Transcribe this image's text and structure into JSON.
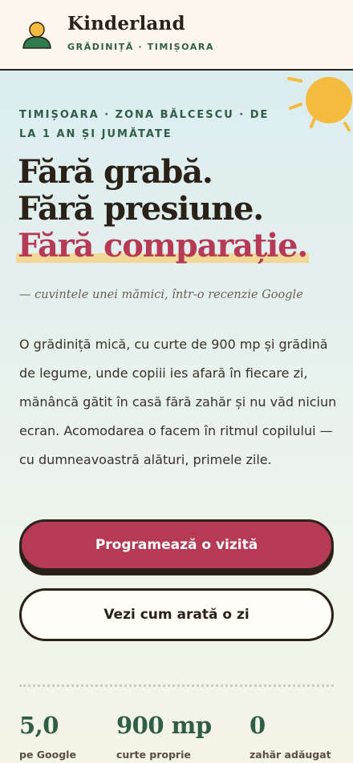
{
  "header": {
    "brand_name": "Kinderland",
    "brand_sub": "GRĂDINIȚĂ · TIMIȘOARA",
    "logo_icon": "child-avatar-icon"
  },
  "hero": {
    "eyebrow": "TIMIȘOARA · ZONA BĂLCESCU · DE LA 1 AN ȘI JUMĂTATE",
    "headline_1": "Fără grabă.",
    "headline_2": "Fără presiune.",
    "headline_3": "Fără comparație.",
    "quote": "— cuvintele unei mămici, într-o recenzie Google",
    "description": "O grădiniță mică, cu curte de 900 mp și grădină de legume, unde copiii ies afară în fiecare zi, mănâncă gătit în casă fără zahăr și nu văd niciun ecran. Acomodarea o facem în ritmul copilului — cu dumneavoastră alături, primele zile.",
    "primary_button": "Programează o vizită",
    "secondary_button": "Vezi cum arată o zi",
    "decoration_icon": "sun-icon"
  },
  "stats": [
    {
      "value": "5,0",
      "label": "pe Google"
    },
    {
      "value": "900 mp",
      "label": "curte proprie"
    },
    {
      "value": "0",
      "label": "zahăr adăugat"
    }
  ],
  "colors": {
    "accent": "#b63a55",
    "green": "#2f5d46",
    "ink": "#2a2118",
    "sun": "#f3bb3f",
    "highlight": "#f3d48a"
  }
}
